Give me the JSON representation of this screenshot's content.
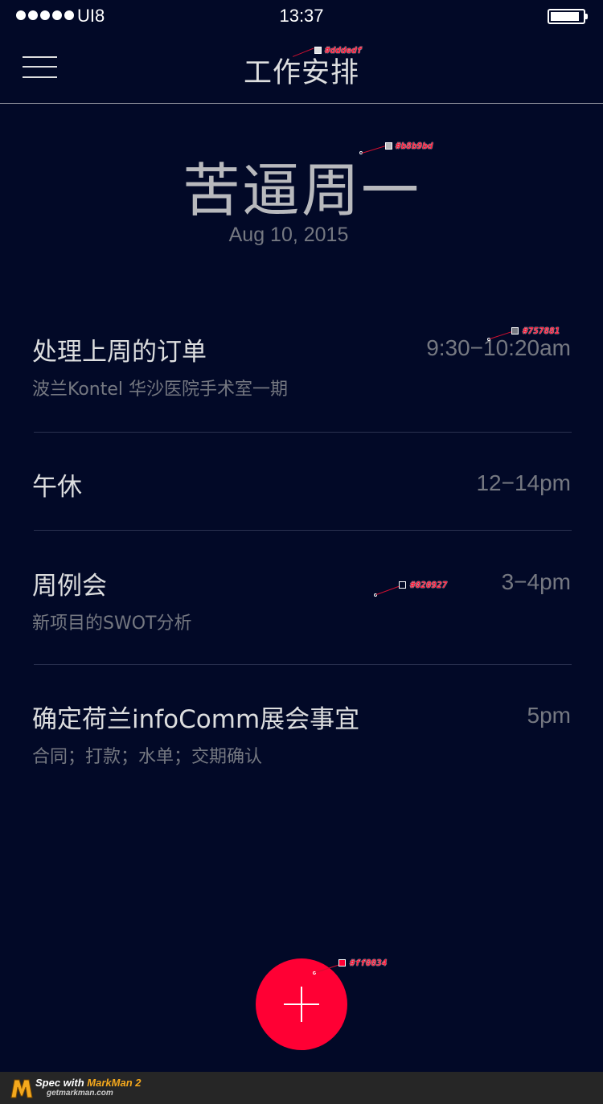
{
  "status_bar": {
    "carrier": "UI8",
    "time": "13:37"
  },
  "nav": {
    "title": "工作安排",
    "menu_icon": "hamburger-menu-icon"
  },
  "header": {
    "day_title": "苦逼周一",
    "date": "Aug 10, 2015"
  },
  "tasks": [
    {
      "title": "处理上周的订单",
      "time": "9:30−10:20am",
      "subtitle": "波兰Kontel  华沙医院手术室一期"
    },
    {
      "title": "午休",
      "time": "12−14pm",
      "subtitle": ""
    },
    {
      "title": "周例会",
      "time": "3−4pm",
      "subtitle": "新项目的SWOT分析"
    },
    {
      "title": "确定荷兰infoComm展会事宜",
      "time": "5pm",
      "subtitle": "合同；打款；水单；交期确认"
    }
  ],
  "fab": {
    "icon": "plus-icon"
  },
  "annotations": {
    "nav_title_color": "#dddedf",
    "day_title_color": "#b8b9bd",
    "time_color": "#757881",
    "background_color": "#020927",
    "fab_color": "#ff0034"
  },
  "footer": {
    "brand_prefix": "Spec with ",
    "brand_name": "MarkMan 2",
    "url": "getmarkman.com"
  }
}
